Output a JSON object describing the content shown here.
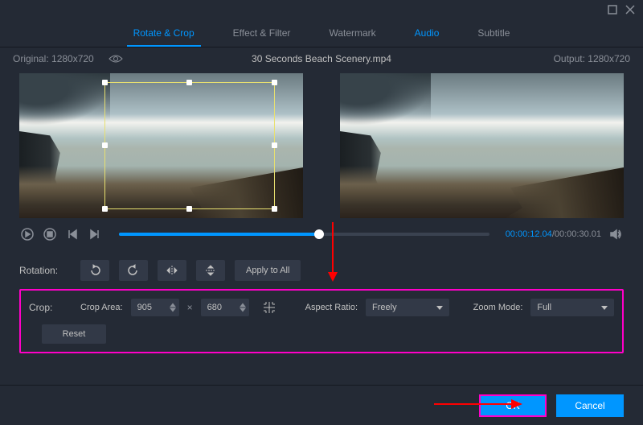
{
  "titlebar": {
    "maximize": "maximize",
    "close": "close"
  },
  "tabs": {
    "rotate_crop": "Rotate & Crop",
    "effect_filter": "Effect & Filter",
    "watermark": "Watermark",
    "audio": "Audio",
    "subtitle": "Subtitle"
  },
  "infobar": {
    "original_label": "Original: 1280x720",
    "filename": "30 Seconds Beach Scenery.mp4",
    "output_label": "Output: 1280x720"
  },
  "time": {
    "current": "00:00:12.04",
    "total": "00:00:30.01"
  },
  "rotation": {
    "label": "Rotation:",
    "apply": "Apply to All"
  },
  "crop": {
    "label": "Crop:",
    "area_label": "Crop Area:",
    "width": "905",
    "height": "680",
    "aspect_label": "Aspect Ratio:",
    "aspect_value": "Freely",
    "zoom_label": "Zoom Mode:",
    "zoom_value": "Full",
    "reset": "Reset",
    "x": "×"
  },
  "footer": {
    "ok": "OK",
    "cancel": "Cancel"
  }
}
